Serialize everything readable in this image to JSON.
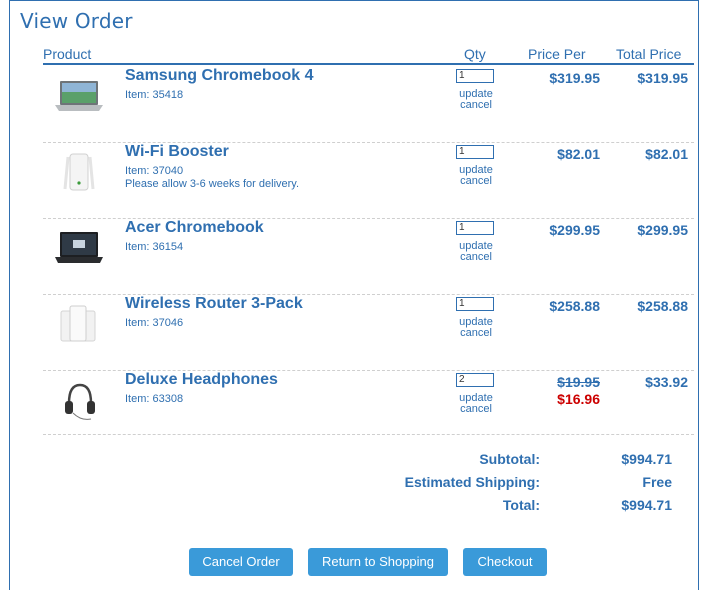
{
  "page": {
    "title": "View Order"
  },
  "columns": {
    "product": "Product",
    "qty": "Qty",
    "price_per": "Price Per",
    "total_price": "Total Price"
  },
  "items": [
    {
      "name": "Samsung Chromebook 4",
      "item": "Item: 35418",
      "note": "",
      "qty": "1",
      "update": "update",
      "cancel": "cancel",
      "price": "$319.95",
      "sale_price": "",
      "total": "$319.95",
      "icon": "laptop-icon"
    },
    {
      "name": "Wi-Fi Booster",
      "item": "Item: 37040",
      "note": "Please allow 3-6 weeks for delivery.",
      "qty": "1",
      "update": "update",
      "cancel": "cancel",
      "price": "$82.01",
      "sale_price": "",
      "total": "$82.01",
      "icon": "wifi-booster-icon"
    },
    {
      "name": "Acer Chromebook",
      "item": "Item: 36154",
      "note": "",
      "qty": "1",
      "update": "update",
      "cancel": "cancel",
      "price": "$299.95",
      "sale_price": "",
      "total": "$299.95",
      "icon": "laptop-icon"
    },
    {
      "name": "Wireless Router 3-Pack",
      "item": "Item: 37046",
      "note": "",
      "qty": "1",
      "update": "update",
      "cancel": "cancel",
      "price": "$258.88",
      "sale_price": "",
      "total": "$258.88",
      "icon": "router-icon"
    },
    {
      "name": "Deluxe Headphones",
      "item": "Item: 63308",
      "note": "",
      "qty": "2",
      "update": "update",
      "cancel": "cancel",
      "price": "$19.95",
      "sale_price": "$16.96",
      "total": "$33.92",
      "icon": "headphones-icon"
    }
  ],
  "summary": {
    "subtotal_label": "Subtotal:",
    "subtotal_value": "$994.71",
    "shipping_label": "Estimated Shipping:",
    "shipping_value": "Free",
    "total_label": "Total:",
    "total_value": "$994.71"
  },
  "buttons": {
    "cancel_order": "Cancel Order",
    "return_shopping": "Return to Shopping",
    "checkout": "Checkout"
  },
  "colors": {
    "accent": "#2f6fb0",
    "button": "#3a9ad9",
    "sale": "#cc0000"
  }
}
